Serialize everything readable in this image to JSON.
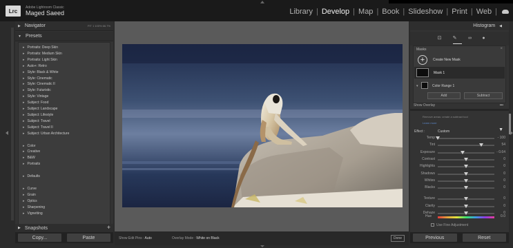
{
  "titlebar": {
    "logo_text": "Lrc",
    "app_name": "Adobe Lightroom Classic",
    "user_name": "Maged Saeed"
  },
  "modules": [
    "Library",
    "Develop",
    "Map",
    "Book",
    "Slideshow",
    "Print",
    "Web"
  ],
  "active_module": "Develop",
  "left": {
    "navigator_label": "Navigator",
    "navigator_zoom": "FIT  1  100%  66.7%",
    "presets_label": "Presets",
    "presets": [
      "Portraits: Deep Skin",
      "Portraits: Medium Skin",
      "Portraits: Light Skin",
      "Auto+: Retro",
      "Style: Black & White",
      "Style: Cinematic",
      "Style: Cinematic II",
      "Style: Futuristic",
      "Style: Vintage",
      "Subject: Food",
      "Subject: Landscape",
      "Subject: Lifestyle",
      "Subject: Travel",
      "Subject: Travel II",
      "Subject: Urban Architecture",
      "Color",
      "Creative",
      "B&W",
      "Portraits",
      "Defaults",
      "Curve",
      "Grain",
      "Optics",
      "Sharpening",
      "Vignetting"
    ],
    "snapshots_label": "Snapshots",
    "copy_label": "Copy...",
    "paste_label": "Paste"
  },
  "toolbar": {
    "show_edit_pins_label": "Show Edit Pins :",
    "show_edit_pins_value": "Auto",
    "overlay_mode_label": "Overlay Mode :",
    "overlay_mode_value": "White on Black",
    "done_label": "Done"
  },
  "right": {
    "histogram_label": "Histogram",
    "masks_label": "Masks",
    "create_new_mask": "Create New Mask",
    "mask1": "Mask 1",
    "color_range": "Color Range 1",
    "add_label": "Add",
    "subtract_label": "Subtract",
    "show_overlay": "Show Overlay",
    "hint_text": "Remove areas: create a subtract tool",
    "hint_link": "Learn more",
    "effect_label": "Effect :",
    "effect_value": "Custom",
    "sliders": [
      {
        "label": "Temp",
        "value": "- 100",
        "pos": 0.0
      },
      {
        "label": "Tint",
        "value": "54",
        "pos": 0.77
      },
      {
        "label": "Exposure",
        "value": "- 0.64",
        "pos": 0.44
      },
      {
        "label": "Contrast",
        "value": "0",
        "pos": 0.5
      },
      {
        "label": "Highlights",
        "value": "0",
        "pos": 0.5
      },
      {
        "label": "Shadows",
        "value": "0",
        "pos": 0.5
      },
      {
        "label": "Whites",
        "value": "0",
        "pos": 0.5
      },
      {
        "label": "Blacks",
        "value": "0",
        "pos": 0.5
      },
      {
        "label": "Texture",
        "value": "0",
        "pos": 0.5
      },
      {
        "label": "Clarity",
        "value": "0",
        "pos": 0.5
      },
      {
        "label": "Dehaze",
        "value": "0",
        "pos": 0.5
      }
    ],
    "hue_label": "Hue",
    "hue_value": "0.0",
    "fine_adjustment": "Use Fine Adjustment",
    "previous_label": "Previous",
    "reset_label": "Reset"
  }
}
